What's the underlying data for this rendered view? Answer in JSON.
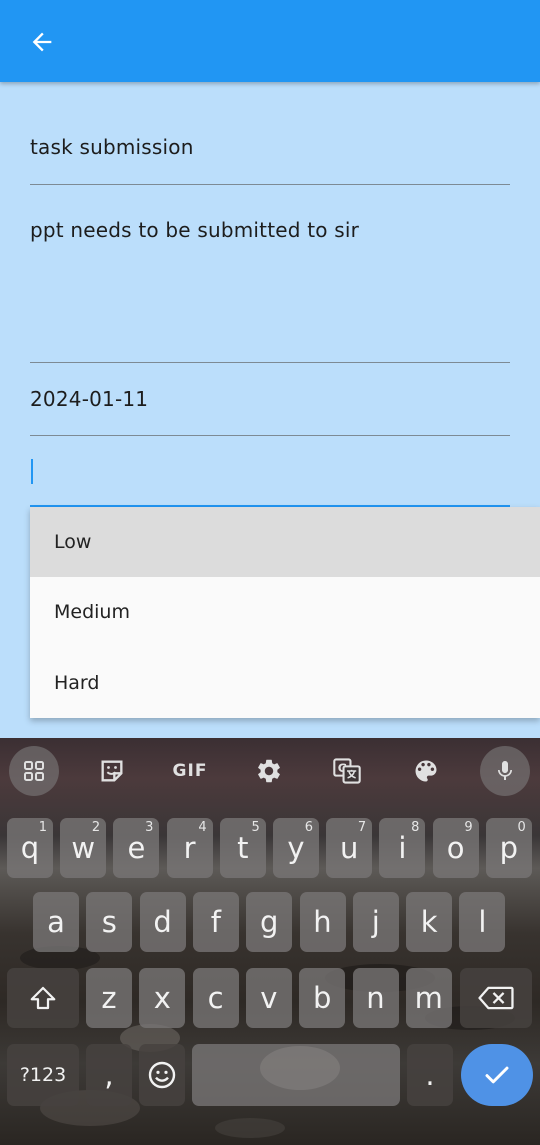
{
  "form": {
    "title_value": "task submission",
    "description_value": "ppt needs to be submitted to sir",
    "date_value": "2024-01-11",
    "priority_value": ""
  },
  "priority_options": [
    "Low",
    "Medium",
    "Hard"
  ],
  "keyboard": {
    "toolbar": {
      "gif_label": "GIF"
    },
    "row1": [
      {
        "k": "q",
        "h": "1"
      },
      {
        "k": "w",
        "h": "2"
      },
      {
        "k": "e",
        "h": "3"
      },
      {
        "k": "r",
        "h": "4"
      },
      {
        "k": "t",
        "h": "5"
      },
      {
        "k": "y",
        "h": "6"
      },
      {
        "k": "u",
        "h": "7"
      },
      {
        "k": "i",
        "h": "8"
      },
      {
        "k": "o",
        "h": "9"
      },
      {
        "k": "p",
        "h": "0"
      }
    ],
    "row2": [
      "a",
      "s",
      "d",
      "f",
      "g",
      "h",
      "j",
      "k",
      "l"
    ],
    "row3": [
      "z",
      "x",
      "c",
      "v",
      "b",
      "n",
      "m"
    ],
    "symbols_label": "?123",
    "comma_label": ",",
    "period_label": "."
  },
  "colors": {
    "app_bar": "#2196f3",
    "background": "#bbdefb",
    "accent": "#2196f3",
    "enter_key": "#4f92e6"
  }
}
